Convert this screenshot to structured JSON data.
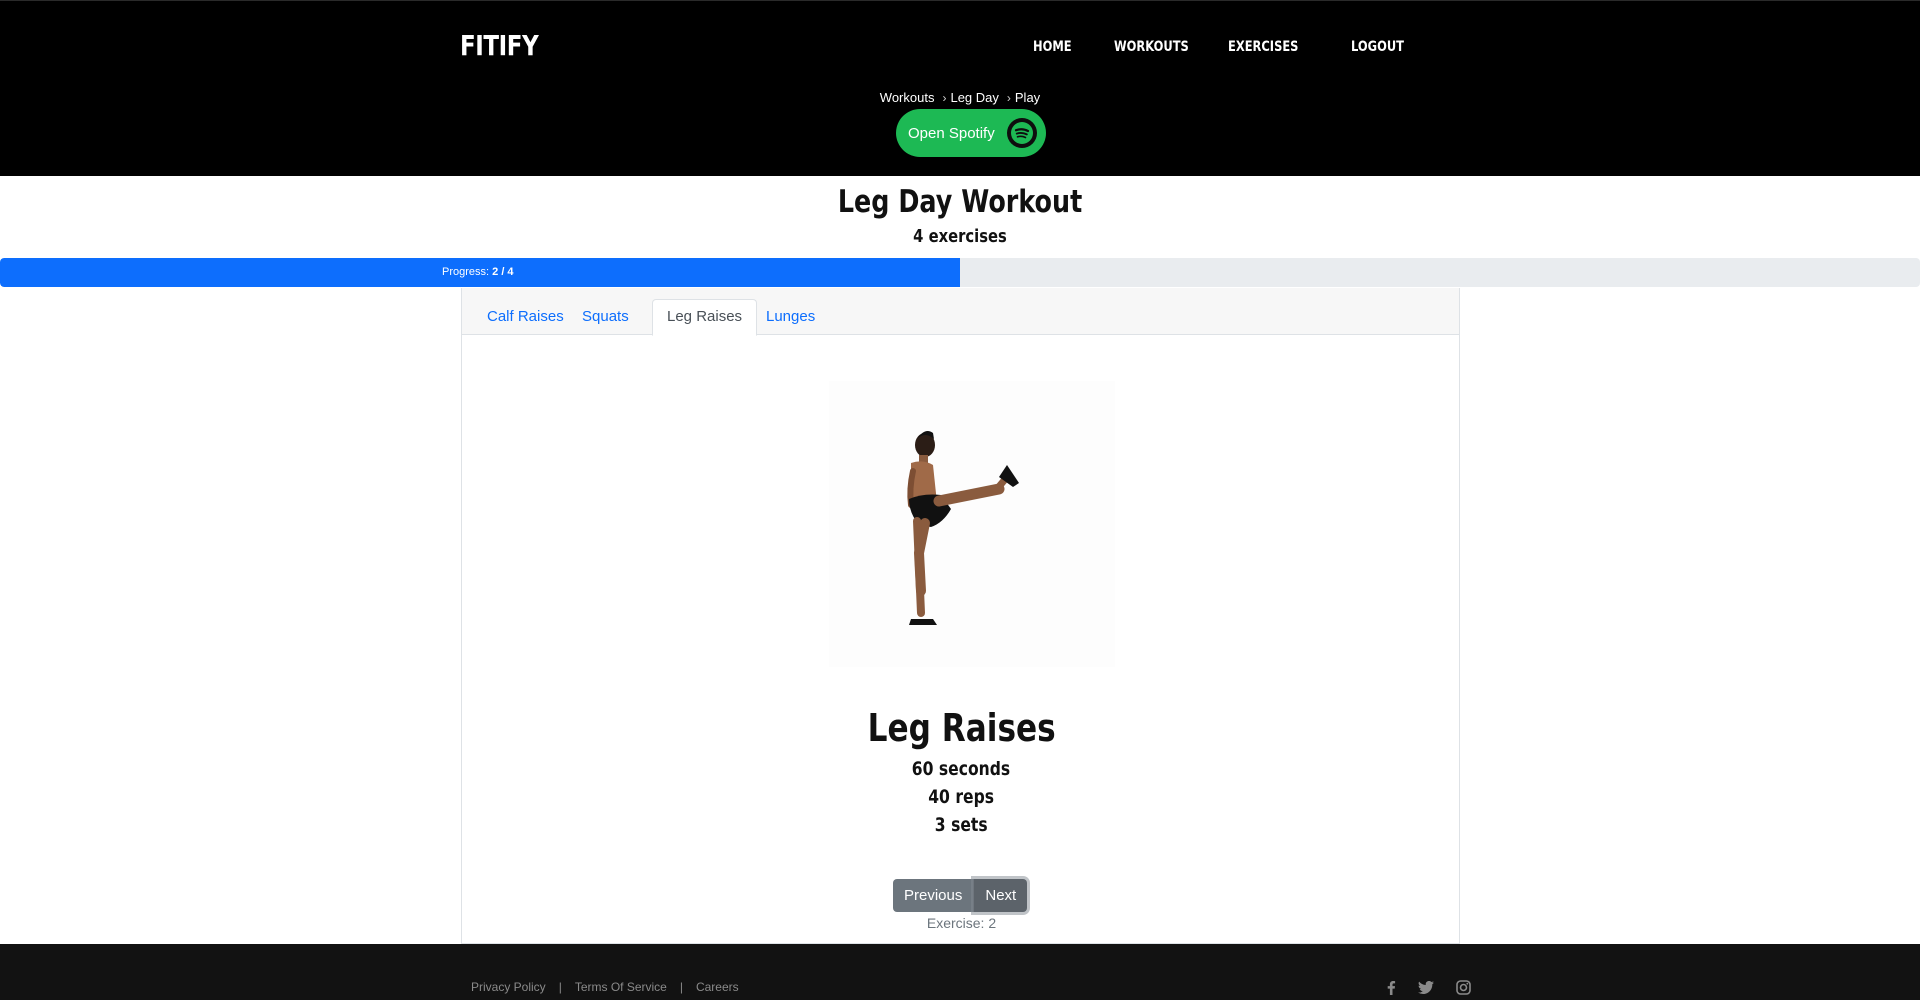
{
  "brand": "FITIFY",
  "nav": {
    "home": "HOME",
    "workouts": "WORKOUTS",
    "exercises": "EXERCISES",
    "logout": "LOGOUT"
  },
  "breadcrumb": {
    "items": [
      "Workouts",
      "Leg Day",
      "Play"
    ],
    "separator": "›"
  },
  "spotify": {
    "label": "Open Spotify",
    "icon": "spotify-icon",
    "color": "#1db954"
  },
  "workout": {
    "title": "Leg Day Workout",
    "count": "4 exercises"
  },
  "progress": {
    "label": "Progress:",
    "value": "2 / 4",
    "fraction": 0.5,
    "color": "#0d6efd"
  },
  "tabs": [
    {
      "label": "Calf Raises",
      "active": false
    },
    {
      "label": "Squats",
      "active": false
    },
    {
      "label": "Leg Raises",
      "active": true
    },
    {
      "label": "Lunges",
      "active": false
    }
  ],
  "exercise": {
    "name": "Leg Raises",
    "duration": "60 seconds",
    "reps": "40 reps",
    "sets": "3 sets",
    "index_text": "Exercise: 2"
  },
  "buttons": {
    "previous": "Previous",
    "next": "Next"
  },
  "footer": {
    "links": [
      "Privacy Policy",
      "Terms Of Service",
      "Careers"
    ],
    "social_icons": [
      "facebook-icon",
      "twitter-icon",
      "instagram-icon"
    ]
  }
}
